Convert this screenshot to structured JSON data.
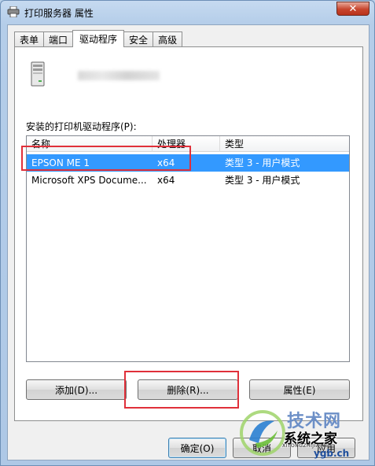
{
  "window": {
    "title": "打印服务器 属性",
    "close_glyph": "✕"
  },
  "tabs": [
    {
      "label": "表单",
      "active": false
    },
    {
      "label": "端口",
      "active": false
    },
    {
      "label": "驱动程序",
      "active": true
    },
    {
      "label": "安全",
      "active": false
    },
    {
      "label": "高级",
      "active": false
    }
  ],
  "drivers": {
    "list_label": "安装的打印机驱动程序(P):",
    "columns": [
      "名称",
      "处理器",
      "类型"
    ],
    "rows": [
      {
        "name": "EPSON ME 1",
        "processor": "x64",
        "type": "类型 3 - 用户模式",
        "selected": true
      },
      {
        "name": "Microsoft XPS Docume...",
        "processor": "x64",
        "type": "类型 3 - 用户模式",
        "selected": false
      }
    ]
  },
  "buttons": {
    "add": "添加(D)...",
    "remove": "删除(R)...",
    "properties": "属性(E)",
    "ok": "确定(O)",
    "cancel": "取消",
    "apply": "应用"
  },
  "watermark": {
    "site": "技术网",
    "name": "系统之家",
    "pinyin": "XITONGZHIJIA.NET",
    "url": "ygb.ch"
  },
  "colors": {
    "selection": "#3399ff",
    "highlight": "#e0303a",
    "accent": "#3c7fb1"
  },
  "icons": {
    "title": "printer-icon",
    "server": "server-tower-icon",
    "close": "close-icon"
  }
}
